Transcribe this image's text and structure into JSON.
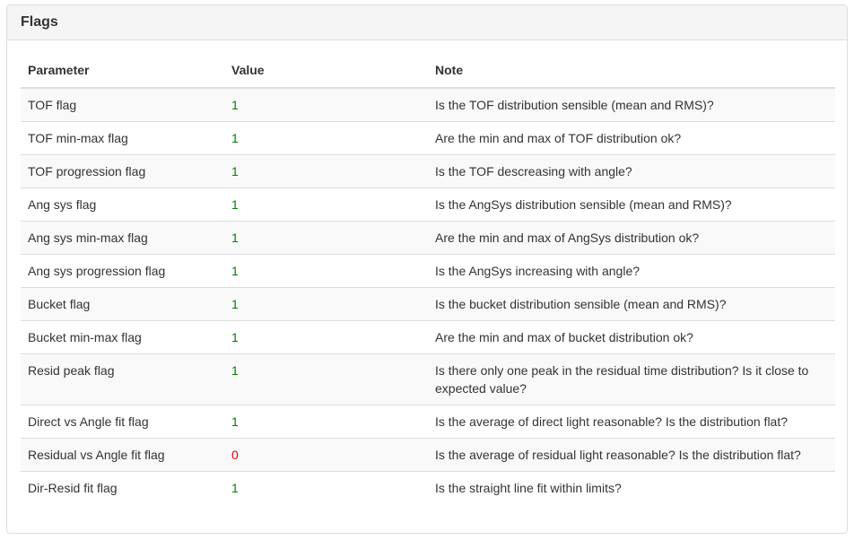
{
  "panel": {
    "title": "Flags"
  },
  "table": {
    "headers": [
      "Parameter",
      "Value",
      "Note"
    ],
    "rows": [
      {
        "parameter": "TOF flag",
        "value": "1",
        "note": "Is the TOF distribution sensible (mean and RMS)?"
      },
      {
        "parameter": "TOF min-max flag",
        "value": "1",
        "note": "Are the min and max of TOF distribution ok?"
      },
      {
        "parameter": "TOF progression flag",
        "value": "1",
        "note": "Is the TOF descreasing with angle?"
      },
      {
        "parameter": "Ang sys flag",
        "value": "1",
        "note": "Is the AngSys distribution sensible (mean and RMS)?"
      },
      {
        "parameter": "Ang sys min-max flag",
        "value": "1",
        "note": "Are the min and max of AngSys distribution ok?"
      },
      {
        "parameter": "Ang sys progression flag",
        "value": "1",
        "note": "Is the AngSys increasing with angle?"
      },
      {
        "parameter": "Bucket flag",
        "value": "1",
        "note": "Is the bucket distribution sensible (mean and RMS)?"
      },
      {
        "parameter": "Bucket min-max flag",
        "value": "1",
        "note": "Are the min and max of bucket distribution ok?"
      },
      {
        "parameter": "Resid peak flag",
        "value": "1",
        "note": "Is there only one peak in the residual time distribution? Is it close to expected value?"
      },
      {
        "parameter": "Direct vs Angle fit flag",
        "value": "1",
        "note": "Is the average of direct light reasonable? Is the distribution flat?"
      },
      {
        "parameter": "Residual vs Angle fit flag",
        "value": "0",
        "note": "Is the average of residual light reasonable? Is the distribution flat?"
      },
      {
        "parameter": "Dir-Resid fit flag",
        "value": "1",
        "note": "Is the straight line fit within limits?"
      }
    ]
  },
  "colors": {
    "pass": "#008000",
    "fail": "#e60000"
  }
}
